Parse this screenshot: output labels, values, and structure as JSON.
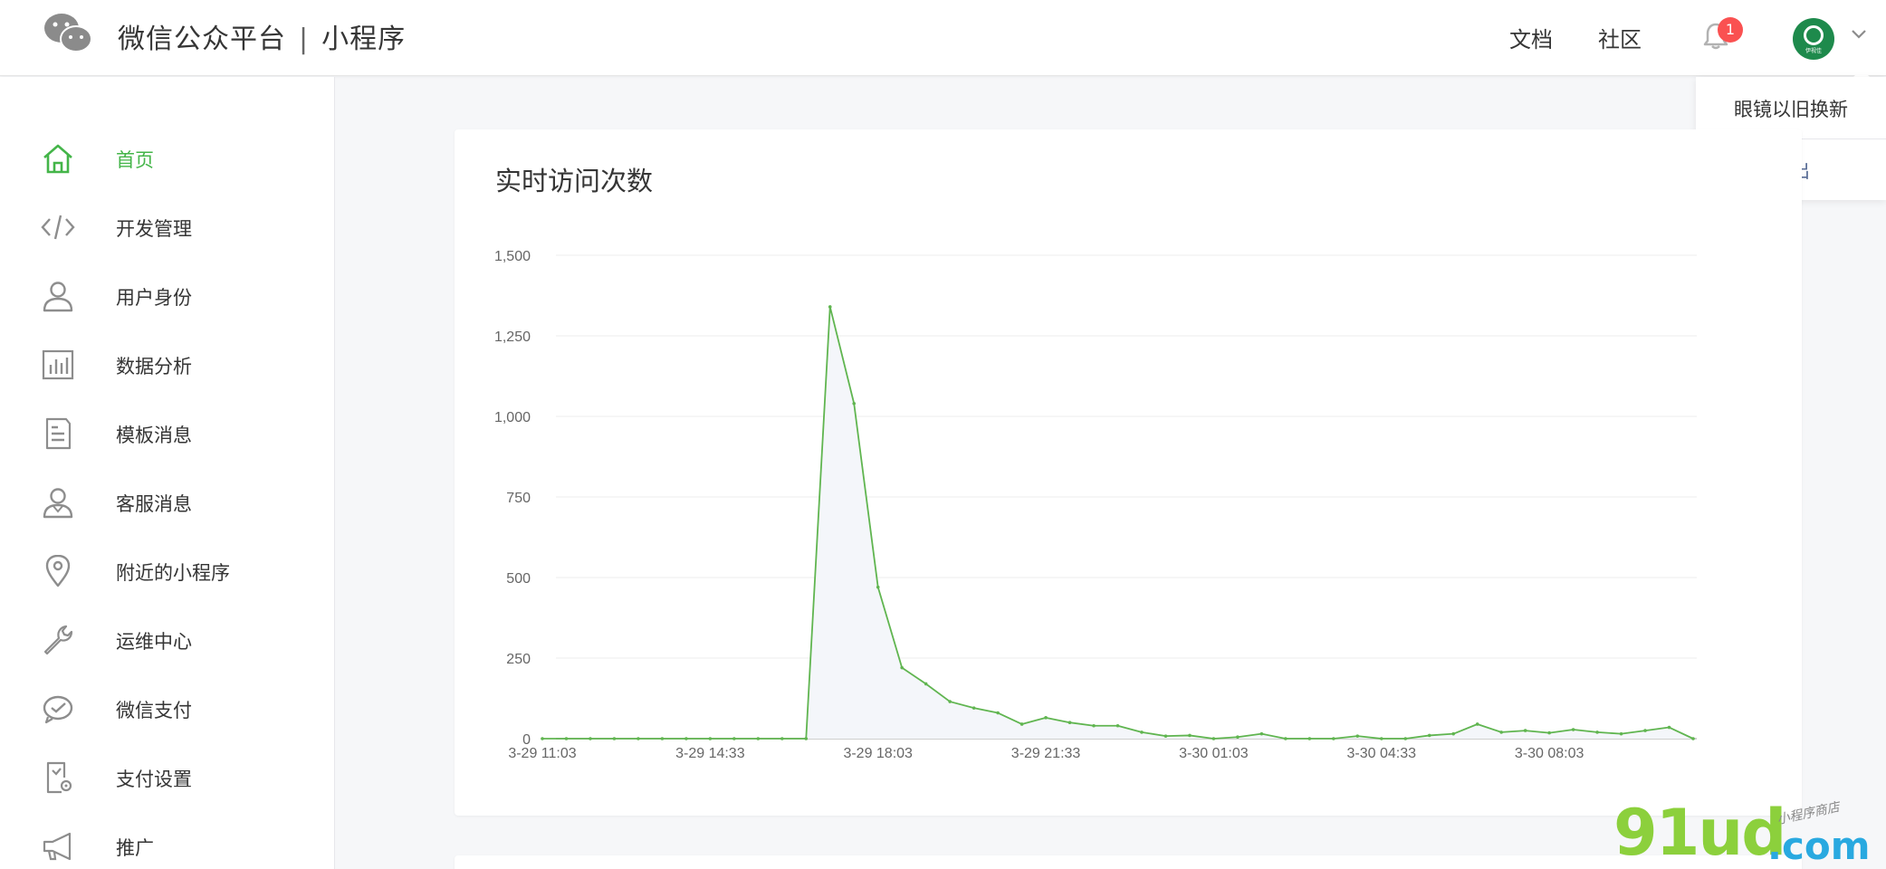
{
  "header": {
    "brand": "微信公众平台",
    "separator": "|",
    "product": "小程序",
    "nav_docs": "文档",
    "nav_community": "社区",
    "notification_count": "1",
    "avatar_text": "伊视佳",
    "icons": {
      "logo": "wechat-logo-icon",
      "bell": "bell-icon",
      "chevron": "chevron-down-icon"
    }
  },
  "dropdown": {
    "account_name": "眼镜以旧换新",
    "logout": "退出"
  },
  "sidebar": {
    "accent_color": "#44b549",
    "items": [
      {
        "label": "首页",
        "icon": "home-icon",
        "active": true
      },
      {
        "label": "开发管理",
        "icon": "code-icon",
        "active": false
      },
      {
        "label": "用户身份",
        "icon": "user-icon",
        "active": false
      },
      {
        "label": "数据分析",
        "icon": "bar-chart-icon",
        "active": false
      },
      {
        "label": "模板消息",
        "icon": "document-icon",
        "active": false
      },
      {
        "label": "客服消息",
        "icon": "customer-service-icon",
        "active": false
      },
      {
        "label": "附近的小程序",
        "icon": "location-pin-icon",
        "active": false
      },
      {
        "label": "运维中心",
        "icon": "wrench-icon",
        "active": false
      },
      {
        "label": "微信支付",
        "icon": "wechat-pay-icon",
        "active": false
      },
      {
        "label": "支付设置",
        "icon": "payment-settings-icon",
        "active": false
      },
      {
        "label": "推广",
        "icon": "megaphone-icon",
        "active": false
      }
    ]
  },
  "main": {
    "card_title": "实时访问次数"
  },
  "chart_data": {
    "type": "area",
    "title": "实时访问次数",
    "xlabel": "",
    "ylabel": "",
    "ylim": [
      0,
      1500
    ],
    "yticks": [
      0,
      250,
      500,
      750,
      1000,
      1250,
      1500
    ],
    "ytick_labels": [
      "0",
      "250",
      "500",
      "750",
      "1,000",
      "1,250",
      "1,500"
    ],
    "xtick_labels": [
      "3-29 11:03",
      "3-29 14:33",
      "3-29 18:03",
      "3-29 21:33",
      "3-30 01:03",
      "3-30 04:33",
      "3-30 08:03"
    ],
    "xtick_indices": [
      0,
      7,
      14,
      21,
      28,
      35,
      42
    ],
    "grid": true,
    "line_color": "#60b550",
    "fill_color": "#f4f6fa",
    "values": [
      0,
      0,
      0,
      0,
      0,
      0,
      0,
      0,
      0,
      0,
      0,
      0,
      1340,
      1040,
      470,
      220,
      170,
      115,
      95,
      80,
      45,
      65,
      50,
      40,
      40,
      20,
      8,
      10,
      0,
      5,
      15,
      0,
      0,
      0,
      8,
      0,
      0,
      10,
      15,
      45,
      20,
      25,
      18,
      28,
      20,
      15,
      25,
      35,
      0
    ]
  },
  "watermark": {
    "main": "91ud",
    "suffix": ".com",
    "tagline": "小程序商店"
  }
}
